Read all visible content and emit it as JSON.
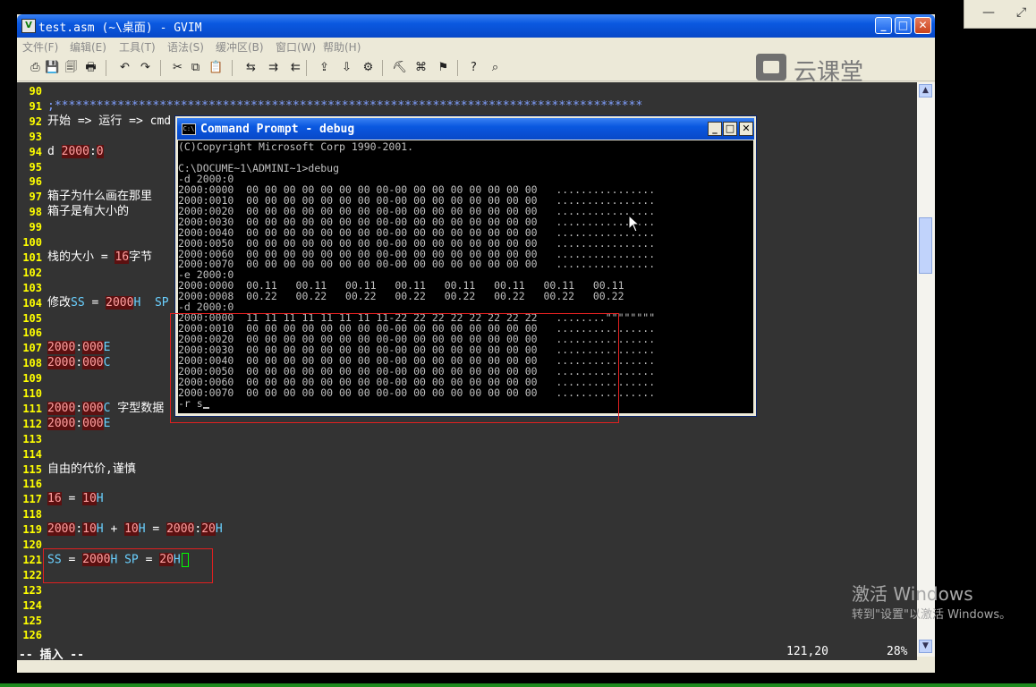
{
  "window": {
    "title": "test.asm (~\\桌面) - GVIM",
    "buttons": {
      "minimize": "_",
      "maximize": "□",
      "close": "✕"
    }
  },
  "menu": [
    "文件(F)",
    "编辑(E)",
    "工具(T)",
    "语法(S)",
    "缓冲区(B)",
    "窗口(W)",
    "帮助(H)"
  ],
  "toolbar": {
    "icons": [
      "open-icon",
      "save-icon",
      "save-all-icon",
      "print-icon",
      "undo-icon",
      "redo-icon",
      "cut-icon",
      "copy-icon",
      "paste-icon",
      "replace-icon",
      "find-next-icon",
      "find-prev-icon",
      "load-session-icon",
      "save-session-icon",
      "run-script-icon",
      "make-icon",
      "shell-icon",
      "tag-jump-icon",
      "help-icon",
      "find-help-icon"
    ],
    "glyphs": [
      "⎙",
      "💾",
      "🗐",
      "🖶",
      "↶",
      "↷",
      "✂",
      "⧉",
      "📋",
      "⇆",
      "⇉",
      "⇇",
      "⇪",
      "⇩",
      "⚙",
      "⛏",
      "⌘",
      "⚑",
      "?",
      "⌕"
    ]
  },
  "brand_logo": "云课堂",
  "editor": {
    "lines": [
      {
        "n": "90",
        "parts": []
      },
      {
        "n": "91",
        "parts": [
          {
            "t": ";************************************************************************************",
            "c": "cmt"
          }
        ]
      },
      {
        "n": "92",
        "parts": [
          {
            "t": "开始 => 运行 => cmd"
          }
        ]
      },
      {
        "n": "93",
        "parts": []
      },
      {
        "n": "94",
        "parts": [
          {
            "t": "d "
          },
          {
            "t": "2000",
            "c": "num"
          },
          {
            "t": ":"
          },
          {
            "t": "0",
            "c": "num"
          }
        ]
      },
      {
        "n": "95",
        "parts": []
      },
      {
        "n": "96",
        "parts": []
      },
      {
        "n": "97",
        "parts": [
          {
            "t": "箱子为什么画在那里"
          }
        ]
      },
      {
        "n": "98",
        "parts": [
          {
            "t": "箱子是有大小的"
          }
        ]
      },
      {
        "n": "99",
        "parts": []
      },
      {
        "n": "100",
        "parts": []
      },
      {
        "n": "101",
        "parts": [
          {
            "t": "栈的大小 = "
          },
          {
            "t": "16",
            "c": "num"
          },
          {
            "t": "字节"
          }
        ]
      },
      {
        "n": "102",
        "parts": []
      },
      {
        "n": "103",
        "parts": []
      },
      {
        "n": "104",
        "parts": [
          {
            "t": "修改"
          },
          {
            "t": "SS",
            "c": "reg"
          },
          {
            "t": " = "
          },
          {
            "t": "2000",
            "c": "num"
          },
          {
            "t": "H",
            "c": "reg"
          },
          {
            "t": "  "
          },
          {
            "t": "SP",
            "c": "reg"
          }
        ]
      },
      {
        "n": "105",
        "parts": []
      },
      {
        "n": "106",
        "parts": []
      },
      {
        "n": "107",
        "parts": [
          {
            "t": "2000",
            "c": "num"
          },
          {
            "t": ":"
          },
          {
            "t": "000",
            "c": "num"
          },
          {
            "t": "E",
            "c": "reg"
          }
        ]
      },
      {
        "n": "108",
        "parts": [
          {
            "t": "2000",
            "c": "num"
          },
          {
            "t": ":"
          },
          {
            "t": "000",
            "c": "num"
          },
          {
            "t": "C",
            "c": "reg"
          }
        ]
      },
      {
        "n": "109",
        "parts": []
      },
      {
        "n": "110",
        "parts": []
      },
      {
        "n": "111",
        "parts": [
          {
            "t": "2000",
            "c": "num"
          },
          {
            "t": ":"
          },
          {
            "t": "000",
            "c": "num"
          },
          {
            "t": "C",
            "c": "reg"
          },
          {
            "t": " 字型数据"
          }
        ]
      },
      {
        "n": "112",
        "parts": [
          {
            "t": "2000",
            "c": "num"
          },
          {
            "t": ":"
          },
          {
            "t": "000",
            "c": "num"
          },
          {
            "t": "E",
            "c": "reg"
          }
        ]
      },
      {
        "n": "113",
        "parts": []
      },
      {
        "n": "114",
        "parts": []
      },
      {
        "n": "115",
        "parts": [
          {
            "t": "自由的代价,谨慎"
          }
        ]
      },
      {
        "n": "116",
        "parts": []
      },
      {
        "n": "117",
        "parts": [
          {
            "t": "16",
            "c": "num"
          },
          {
            "t": " = "
          },
          {
            "t": "10",
            "c": "num"
          },
          {
            "t": "H",
            "c": "reg"
          }
        ]
      },
      {
        "n": "118",
        "parts": []
      },
      {
        "n": "119",
        "parts": [
          {
            "t": "2000",
            "c": "num"
          },
          {
            "t": ":"
          },
          {
            "t": "10",
            "c": "num"
          },
          {
            "t": "H",
            "c": "reg"
          },
          {
            "t": " + "
          },
          {
            "t": "10",
            "c": "num"
          },
          {
            "t": "H",
            "c": "reg"
          },
          {
            "t": " = "
          },
          {
            "t": "2000",
            "c": "num"
          },
          {
            "t": ":"
          },
          {
            "t": "20",
            "c": "num"
          },
          {
            "t": "H",
            "c": "reg"
          }
        ]
      },
      {
        "n": "120",
        "parts": []
      },
      {
        "n": "121",
        "parts": [
          {
            "t": "SS",
            "c": "reg"
          },
          {
            "t": " = "
          },
          {
            "t": "2000",
            "c": "num"
          },
          {
            "t": "H",
            "c": "reg"
          },
          {
            "t": " "
          },
          {
            "t": "SP",
            "c": "reg"
          },
          {
            "t": " = "
          },
          {
            "t": "20",
            "c": "num"
          },
          {
            "t": "H",
            "c": "reg"
          },
          {
            "t": "",
            "c": "cursor"
          }
        ]
      },
      {
        "n": "122",
        "parts": []
      },
      {
        "n": "123",
        "parts": []
      },
      {
        "n": "124",
        "parts": []
      },
      {
        "n": "125",
        "parts": []
      },
      {
        "n": "126",
        "parts": []
      }
    ]
  },
  "status": {
    "mode": "-- 插入 --",
    "position": "121,20",
    "percent": "28%"
  },
  "cmd": {
    "title": "Command Prompt - debug",
    "icon_text": "C:\\",
    "lines": [
      "(C)Copyright Microsoft Corp 1990-2001.",
      "",
      "C:\\DOCUME~1\\ADMINI~1>debug",
      "-d 2000:0",
      "2000:0000  00 00 00 00 00 00 00 00-00 00 00 00 00 00 00 00   ................",
      "2000:0010  00 00 00 00 00 00 00 00-00 00 00 00 00 00 00 00   ................",
      "2000:0020  00 00 00 00 00 00 00 00-00 00 00 00 00 00 00 00   ................",
      "2000:0030  00 00 00 00 00 00 00 00-00 00 00 00 00 00 00 00   ................",
      "2000:0040  00 00 00 00 00 00 00 00-00 00 00 00 00 00 00 00   ................",
      "2000:0050  00 00 00 00 00 00 00 00-00 00 00 00 00 00 00 00   ................",
      "2000:0060  00 00 00 00 00 00 00 00-00 00 00 00 00 00 00 00   ................",
      "2000:0070  00 00 00 00 00 00 00 00-00 00 00 00 00 00 00 00   ................",
      "-e 2000:0",
      "2000:0000  00.11   00.11   00.11   00.11   00.11   00.11   00.11   00.11",
      "2000:0008  00.22   00.22   00.22   00.22   00.22   00.22   00.22   00.22",
      "-d 2000:0",
      "2000:0000  11 11 11 11 11 11 11 11-22 22 22 22 22 22 22 22   ........\"\"\"\"\"\"\"\"",
      "2000:0010  00 00 00 00 00 00 00 00-00 00 00 00 00 00 00 00   ................",
      "2000:0020  00 00 00 00 00 00 00 00-00 00 00 00 00 00 00 00   ................",
      "2000:0030  00 00 00 00 00 00 00 00-00 00 00 00 00 00 00 00   ................",
      "2000:0040  00 00 00 00 00 00 00 00-00 00 00 00 00 00 00 00   ................",
      "2000:0050  00 00 00 00 00 00 00 00-00 00 00 00 00 00 00 00   ................",
      "2000:0060  00 00 00 00 00 00 00 00-00 00 00 00 00 00 00 00   ................",
      "2000:0070  00 00 00 00 00 00 00 00-00 00 00 00 00 00 00 00   ................",
      "-r s"
    ]
  },
  "side_window": {
    "minimize": "—",
    "restore": "⤢"
  },
  "watermark": {
    "line1": "激活 Windows",
    "line2": "转到\"设置\"以激活 Windows。"
  }
}
